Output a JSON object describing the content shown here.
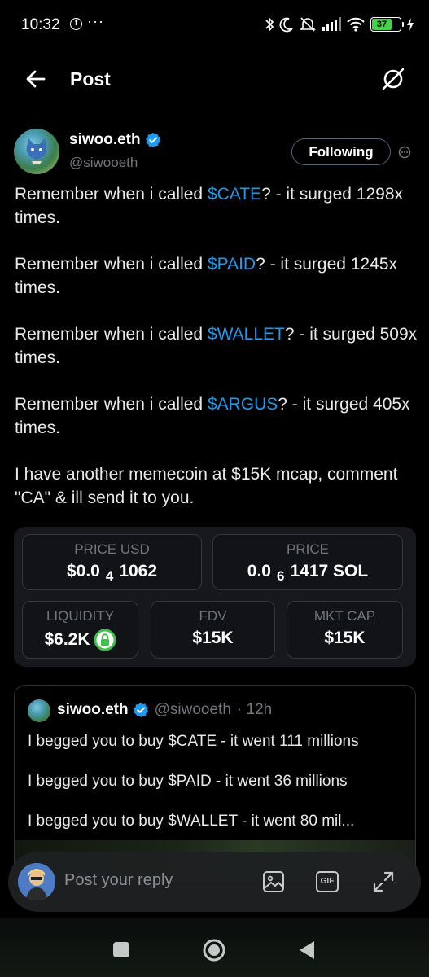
{
  "status_bar": {
    "time": "10:32",
    "fb_glyph": "f",
    "dots": "···",
    "battery": "37",
    "icons": [
      "facebook-icon",
      "bluetooth-icon",
      "moon-icon",
      "mute-icon",
      "signal-icon",
      "wifi-icon",
      "battery-icon",
      "charging-icon"
    ]
  },
  "header": {
    "title": "Post",
    "back_icon": "arrow-left-icon",
    "grok_icon": "grok-icon"
  },
  "author": {
    "name": "siwoo.eth",
    "handle": "@siwooeth",
    "follow_label": "Following",
    "verified_color": "#1d9bf0"
  },
  "tweet": {
    "paragraphs": [
      {
        "prefix": "Remember when i called ",
        "cashtag": "$CATE",
        "suffix": "? - it surged 1298x times."
      },
      {
        "prefix": "Remember when i called ",
        "cashtag": "$PAID",
        "suffix": "? - it surged 1245x times."
      },
      {
        "prefix": "Remember when i called ",
        "cashtag": "$WALLET",
        "suffix": "? - it surged 509x times."
      },
      {
        "prefix": "Remember when i called ",
        "cashtag": "$ARGUS",
        "suffix": "? - it surged 405x times."
      }
    ],
    "closing": "I have another memecoin at $15K mcap, comment \"CA\" & ill send it to you."
  },
  "token_card": {
    "price_usd_label": "PRICE USD",
    "price_usd_prefix": "$0.0",
    "price_usd_sub": "4",
    "price_usd_suffix": "1062",
    "price_label": "PRICE",
    "price_prefix": "0.0",
    "price_sub": "6",
    "price_suffix": "1417 SOL",
    "liquidity_label": "LIQUIDITY",
    "liquidity_value": "$6.2K",
    "fdv_label": "FDV",
    "fdv_value": "$15K",
    "mktcap_label": "MKT CAP",
    "mktcap_value": "$15K",
    "lock_color": "#3ec14a"
  },
  "quote": {
    "name": "siwoo.eth",
    "handle": "@siwooeth",
    "time": "· 12h",
    "lines": [
      "I begged you to buy $CATE - it went 111 millions",
      "I begged you to buy $PAID - it went 36 millions",
      "I begged you to buy $WALLET - it went 80 mil..."
    ]
  },
  "reply": {
    "placeholder": "Post your reply",
    "gif_label": "GIF",
    "icons": [
      "image-icon",
      "gif-icon",
      "expand-icon"
    ]
  },
  "nav": {
    "icons": [
      "recents-icon",
      "home-icon",
      "back-icon"
    ]
  },
  "colors": {
    "accent": "#1d9bf0",
    "background": "#000000",
    "muted": "#71767b"
  }
}
